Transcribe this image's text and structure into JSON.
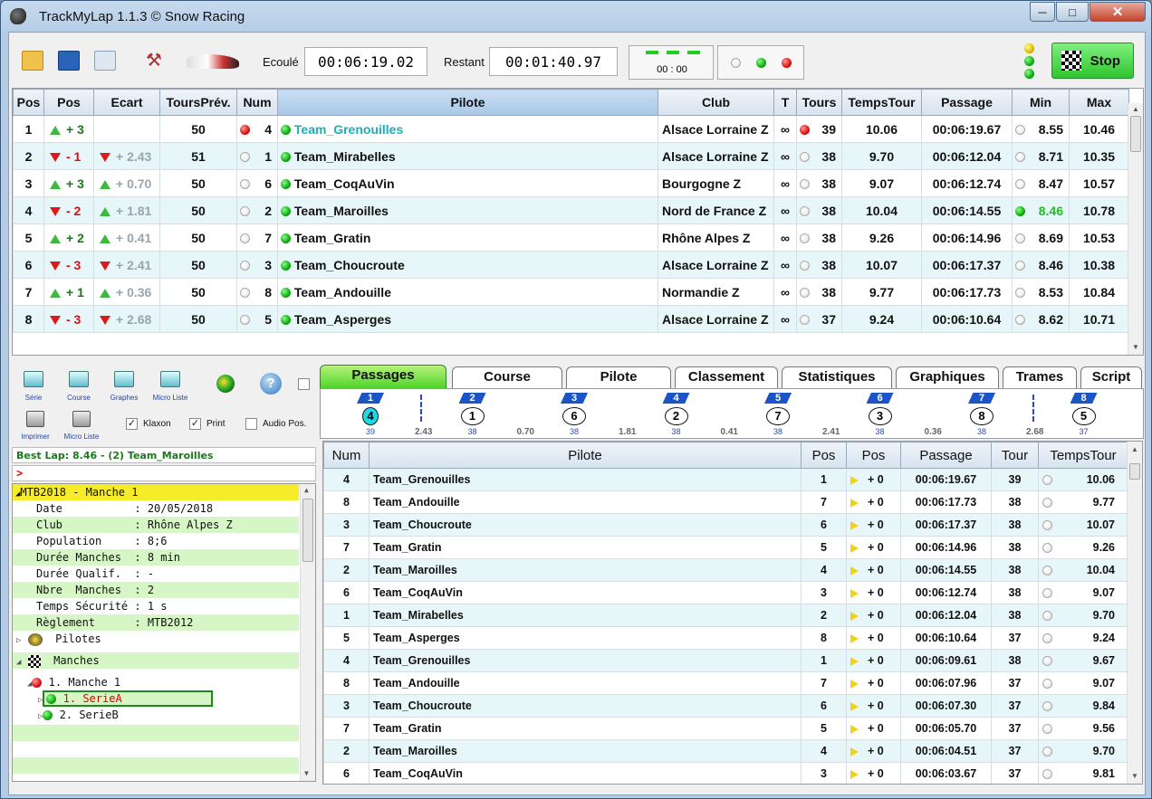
{
  "window": {
    "title": "TrackMyLap 1.1.3  © Snow Racing",
    "min": "─",
    "max": "□",
    "close": "✕"
  },
  "toolbar": {
    "elapsed_label": "Ecoulé",
    "elapsed": "00:06:19.02",
    "remaining_label": "Restant",
    "remaining": "00:01:40.97",
    "clock": "00 : 00",
    "stop_label": "Stop"
  },
  "grid1": {
    "headers": [
      "Pos",
      "Pos",
      "Ecart",
      "ToursPrév.",
      "Num",
      "Pilote",
      "Club",
      "T",
      "Tours",
      "TempsTour",
      "Passage",
      "Min",
      "Max"
    ],
    "rows": [
      {
        "pos": "1",
        "dir": "up",
        "chg": "+ 3",
        "ecart": "",
        "ecdir": "",
        "prev": "50",
        "numdot": "r",
        "num": "4",
        "pilote": "Team_Grenouilles",
        "club": "Alsace Lorraine Z",
        "t": "∞",
        "tdot": "r",
        "tours": "39",
        "temps": "10.06",
        "passage": "00:06:19.67",
        "mdot": "w",
        "min": "8.55",
        "max": "10.46"
      },
      {
        "pos": "2",
        "dir": "dn",
        "chg": "- 1",
        "ecart": "+ 2.43",
        "ecdir": "dn",
        "prev": "51",
        "numdot": "w",
        "num": "1",
        "pilote": "Team_Mirabelles",
        "club": "Alsace Lorraine Z",
        "t": "∞",
        "tdot": "w",
        "tours": "38",
        "temps": "9.70",
        "passage": "00:06:12.04",
        "mdot": "w",
        "min": "8.71",
        "max": "10.35"
      },
      {
        "pos": "3",
        "dir": "up",
        "chg": "+ 3",
        "ecart": "+ 0.70",
        "ecdir": "up",
        "prev": "50",
        "numdot": "w",
        "num": "6",
        "pilote": "Team_CoqAuVin",
        "club": "Bourgogne Z",
        "t": "∞",
        "tdot": "w",
        "tours": "38",
        "temps": "9.07",
        "passage": "00:06:12.74",
        "mdot": "w",
        "min": "8.47",
        "max": "10.57"
      },
      {
        "pos": "4",
        "dir": "dn",
        "chg": "- 2",
        "ecart": "+ 1.81",
        "ecdir": "up",
        "prev": "50",
        "numdot": "w",
        "num": "2",
        "pilote": "Team_Maroilles",
        "club": "Nord de France Z",
        "t": "∞",
        "tdot": "w",
        "tours": "38",
        "temps": "10.04",
        "passage": "00:06:14.55",
        "mdot": "g",
        "min": "8.46",
        "max": "10.78"
      },
      {
        "pos": "5",
        "dir": "up",
        "chg": "+ 2",
        "ecart": "+ 0.41",
        "ecdir": "up",
        "prev": "50",
        "numdot": "w",
        "num": "7",
        "pilote": "Team_Gratin",
        "club": "Rhône Alpes Z",
        "t": "∞",
        "tdot": "w",
        "tours": "38",
        "temps": "9.26",
        "passage": "00:06:14.96",
        "mdot": "w",
        "min": "8.69",
        "max": "10.53"
      },
      {
        "pos": "6",
        "dir": "dn",
        "chg": "- 3",
        "ecart": "+ 2.41",
        "ecdir": "dn",
        "prev": "50",
        "numdot": "w",
        "num": "3",
        "pilote": "Team_Choucroute",
        "club": "Alsace Lorraine Z",
        "t": "∞",
        "tdot": "w",
        "tours": "38",
        "temps": "10.07",
        "passage": "00:06:17.37",
        "mdot": "w",
        "min": "8.46",
        "max": "10.38"
      },
      {
        "pos": "7",
        "dir": "up",
        "chg": "+ 1",
        "ecart": "+ 0.36",
        "ecdir": "up",
        "prev": "50",
        "numdot": "w",
        "num": "8",
        "pilote": "Team_Andouille",
        "club": "Normandie Z",
        "t": "∞",
        "tdot": "w",
        "tours": "38",
        "temps": "9.77",
        "passage": "00:06:17.73",
        "mdot": "w",
        "min": "8.53",
        "max": "10.84"
      },
      {
        "pos": "8",
        "dir": "dn",
        "chg": "- 3",
        "ecart": "+ 2.68",
        "ecdir": "dn",
        "prev": "50",
        "numdot": "w",
        "num": "5",
        "pilote": "Team_Asperges",
        "club": "Alsace Lorraine Z",
        "t": "∞",
        "tdot": "w",
        "tours": "37",
        "temps": "9.24",
        "passage": "00:06:10.64",
        "mdot": "w",
        "min": "8.62",
        "max": "10.71"
      }
    ]
  },
  "left": {
    "buttons": [
      "Série",
      "Course",
      "Graphes",
      "Micro Liste"
    ],
    "print_buttons": [
      "Imprimer",
      "Micro Liste"
    ],
    "klaxon": "Klaxon",
    "print": "Print",
    "audio": "Audio Pos.",
    "bestlap": "Best Lap:  8.46 - (2) Team_Maroilles",
    "prompt": ">",
    "tree_title": "MTB2018 - Manche 1",
    "tree_props": [
      "Date           : 20/05/2018",
      "Club           : Rhône Alpes Z",
      "Population     : 8;6",
      "Durée Manches  : 8 min",
      "Durée Qualif.  : -",
      "Nbre  Manches  : 2",
      "Temps Sécurité : 1 s",
      "Règlement      : MTB2012"
    ],
    "pilotes": "Pilotes",
    "manches": "Manches",
    "manche1": "1. Manche 1",
    "serieA": "1. SerieA",
    "serieB": "2. SerieB"
  },
  "tabs": [
    "Passages",
    "Course",
    "Pilote",
    "Classement",
    "Statistiques",
    "Graphiques",
    "Trames",
    "Script"
  ],
  "strip": {
    "positions": [
      "1",
      "2",
      "3",
      "4",
      "5",
      "6",
      "7",
      "8"
    ],
    "nums": [
      "4",
      "1",
      "6",
      "2",
      "7",
      "3",
      "8",
      "5"
    ],
    "laps": [
      "39",
      "38",
      "38",
      "38",
      "38",
      "38",
      "38",
      "37"
    ],
    "gaps": [
      "2.43",
      "0.70",
      "1.81",
      "0.41",
      "2.41",
      "0.36",
      "2.68"
    ]
  },
  "grid2": {
    "headers": [
      "Num",
      "Pilote",
      "Pos",
      "Pos",
      "Passage",
      "Tour",
      "TempsTour"
    ],
    "rows": [
      {
        "num": "4",
        "pilote": "Team_Grenouilles",
        "green": true,
        "pos": "1",
        "chg": "+ 0",
        "passage": "00:06:19.67",
        "tour": "39",
        "temps": "10.06"
      },
      {
        "num": "8",
        "pilote": "Team_Andouille",
        "green": false,
        "pos": "7",
        "chg": "+ 0",
        "passage": "00:06:17.73",
        "tour": "38",
        "temps": "9.77"
      },
      {
        "num": "3",
        "pilote": "Team_Choucroute",
        "green": false,
        "pos": "6",
        "chg": "+ 0",
        "passage": "00:06:17.37",
        "tour": "38",
        "temps": "10.07"
      },
      {
        "num": "7",
        "pilote": "Team_Gratin",
        "green": false,
        "pos": "5",
        "chg": "+ 0",
        "passage": "00:06:14.96",
        "tour": "38",
        "temps": "9.26"
      },
      {
        "num": "2",
        "pilote": "Team_Maroilles",
        "green": false,
        "pos": "4",
        "chg": "+ 0",
        "passage": "00:06:14.55",
        "tour": "38",
        "temps": "10.04"
      },
      {
        "num": "6",
        "pilote": "Team_CoqAuVin",
        "green": false,
        "pos": "3",
        "chg": "+ 0",
        "passage": "00:06:12.74",
        "tour": "38",
        "temps": "9.07"
      },
      {
        "num": "1",
        "pilote": "Team_Mirabelles",
        "green": false,
        "pos": "2",
        "chg": "+ 0",
        "passage": "00:06:12.04",
        "tour": "38",
        "temps": "9.70"
      },
      {
        "num": "5",
        "pilote": "Team_Asperges",
        "green": false,
        "pos": "8",
        "chg": "+ 0",
        "passage": "00:06:10.64",
        "tour": "37",
        "temps": "9.24"
      },
      {
        "num": "4",
        "pilote": "Team_Grenouilles",
        "green": true,
        "pos": "1",
        "chg": "+ 0",
        "passage": "00:06:09.61",
        "tour": "38",
        "temps": "9.67"
      },
      {
        "num": "8",
        "pilote": "Team_Andouille",
        "green": false,
        "pos": "7",
        "chg": "+ 0",
        "passage": "00:06:07.96",
        "tour": "37",
        "temps": "9.07"
      },
      {
        "num": "3",
        "pilote": "Team_Choucroute",
        "green": false,
        "pos": "6",
        "chg": "+ 0",
        "passage": "00:06:07.30",
        "tour": "37",
        "temps": "9.84"
      },
      {
        "num": "7",
        "pilote": "Team_Gratin",
        "green": false,
        "pos": "5",
        "chg": "+ 0",
        "passage": "00:06:05.70",
        "tour": "37",
        "temps": "9.56"
      },
      {
        "num": "2",
        "pilote": "Team_Maroilles",
        "green": false,
        "pos": "4",
        "chg": "+ 0",
        "passage": "00:06:04.51",
        "tour": "37",
        "temps": "9.70"
      },
      {
        "num": "6",
        "pilote": "Team_CoqAuVin",
        "green": false,
        "pos": "3",
        "chg": "+ 0",
        "passage": "00:06:03.67",
        "tour": "37",
        "temps": "9.81"
      }
    ]
  }
}
